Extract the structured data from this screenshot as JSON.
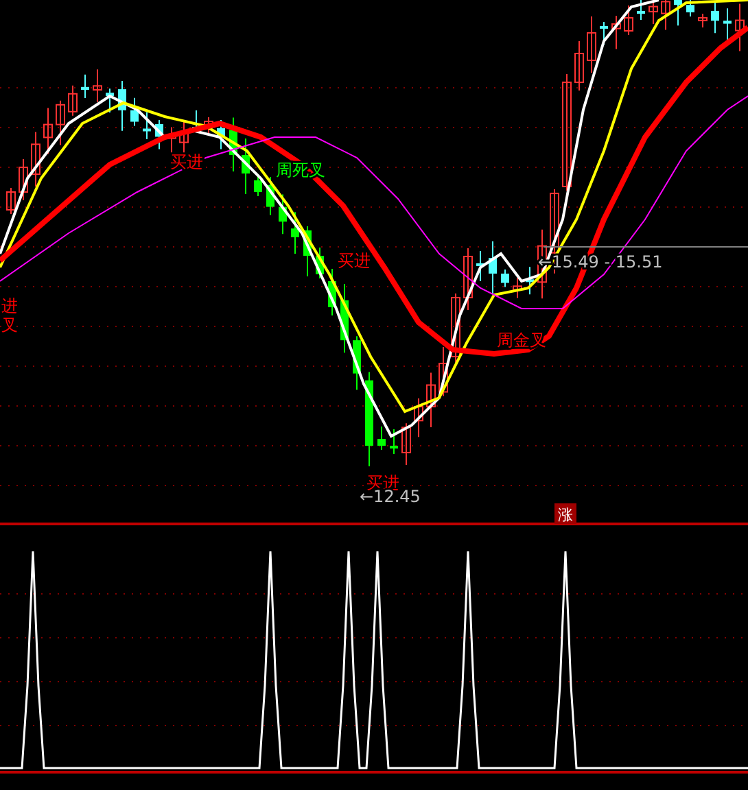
{
  "chart": {
    "annotations": [
      {
        "text": "买进",
        "color": "#ff0000"
      },
      {
        "text": "周死叉",
        "color": "#00ff00"
      },
      {
        "text": "买进",
        "color": "#ff0000"
      },
      {
        "text": "买进",
        "color": "#ff0000"
      },
      {
        "text": "周金叉",
        "color": "#ff0000"
      },
      {
        "text": "进",
        "color": "#ff0000"
      },
      {
        "text": "叉",
        "color": "#ff0000"
      }
    ],
    "price_marks": [
      {
        "text": "←12.45"
      },
      {
        "text": "←15.49 - 15.51"
      }
    ]
  },
  "indicator_panel": {
    "badge": "涨"
  }
}
